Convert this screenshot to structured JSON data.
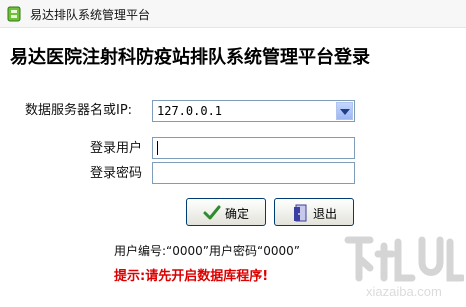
{
  "window": {
    "title": "易达排队系统管理平台"
  },
  "main": {
    "heading": "易达医院注射科防疫站排队系统管理平台登录",
    "server_label": "数据服务器名或IP:",
    "server_value": "127.0.0.1",
    "user_label": "登录用户",
    "user_value": "",
    "password_label": "登录密码",
    "password_value": "",
    "ok_button": "确定",
    "exit_button": "退出",
    "default_hint": "用户编号:“0000”用户密码“0000”",
    "warning": "提示:请先开启数据库程序!"
  },
  "watermark": {
    "text": "xiazaiba.com"
  },
  "colors": {
    "warning": "#dd0000",
    "ok_check": "#2e8b2e",
    "exit_icon": "#3a3fa0"
  },
  "icons": {
    "app": "app-logo-icon",
    "ok": "check-icon",
    "exit": "exit-door-icon",
    "dropdown": "chevron-down-icon"
  }
}
